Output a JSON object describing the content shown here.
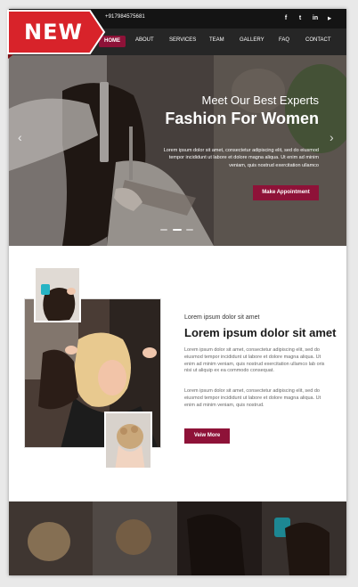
{
  "badge": {
    "label": "NEW",
    "color": "#d8232a"
  },
  "topbar": {
    "phone": "+917984575681",
    "social": [
      {
        "icon": "facebook-icon",
        "glyph": "f"
      },
      {
        "icon": "twitter-icon",
        "glyph": "t"
      },
      {
        "icon": "linkedin-icon",
        "glyph": "in"
      },
      {
        "icon": "youtube-icon",
        "glyph": "▶"
      }
    ]
  },
  "nav": {
    "items": [
      {
        "label": "HOME",
        "active": true
      },
      {
        "label": "ABOUT"
      },
      {
        "label": "SERVICES"
      },
      {
        "label": "TEAM"
      },
      {
        "label": "GALLERY"
      },
      {
        "label": "FAQ"
      },
      {
        "label": "CONTACT"
      }
    ]
  },
  "hero": {
    "subtitle": "Meet Our Best Experts",
    "title": "Fashion For Women",
    "text": "Lorem ipsum dolor sit amet, consectetur adipiscing elit, sed do eiusmod tempor incididunt ut labore et dolore magna aliqua. Ut enim ad minim veniam, quis nostrud exercitation ullamco",
    "button": "Make Appointment",
    "prev": "‹",
    "next": "›"
  },
  "about": {
    "subtitle": "Lorem ipsum dolor sit amet",
    "title": "Lorem ipsum dolor sit amet",
    "para1": "Lorem ipsum dolor sit amet, consectetur adipiscing elit, sed do eiusmod tempor incididunt ut labore et dolore magna aliqua. Ut enim ad minim veniam, quis nostrud exercitation ullamco lab oris nisi ut aliquip ex ea commodo consequat.",
    "para2": "Lorem ipsum dolor sit amet, consectetur adipiscing elit, sed do eiusmod tempor incididunt ut labore et dolore magna aliqua. Ut enim ad minim veniam, quis nostrud.",
    "button": "Veiw More"
  },
  "colors": {
    "accent": "#8e1238",
    "topbar": "#141414",
    "nav": "#262626"
  }
}
